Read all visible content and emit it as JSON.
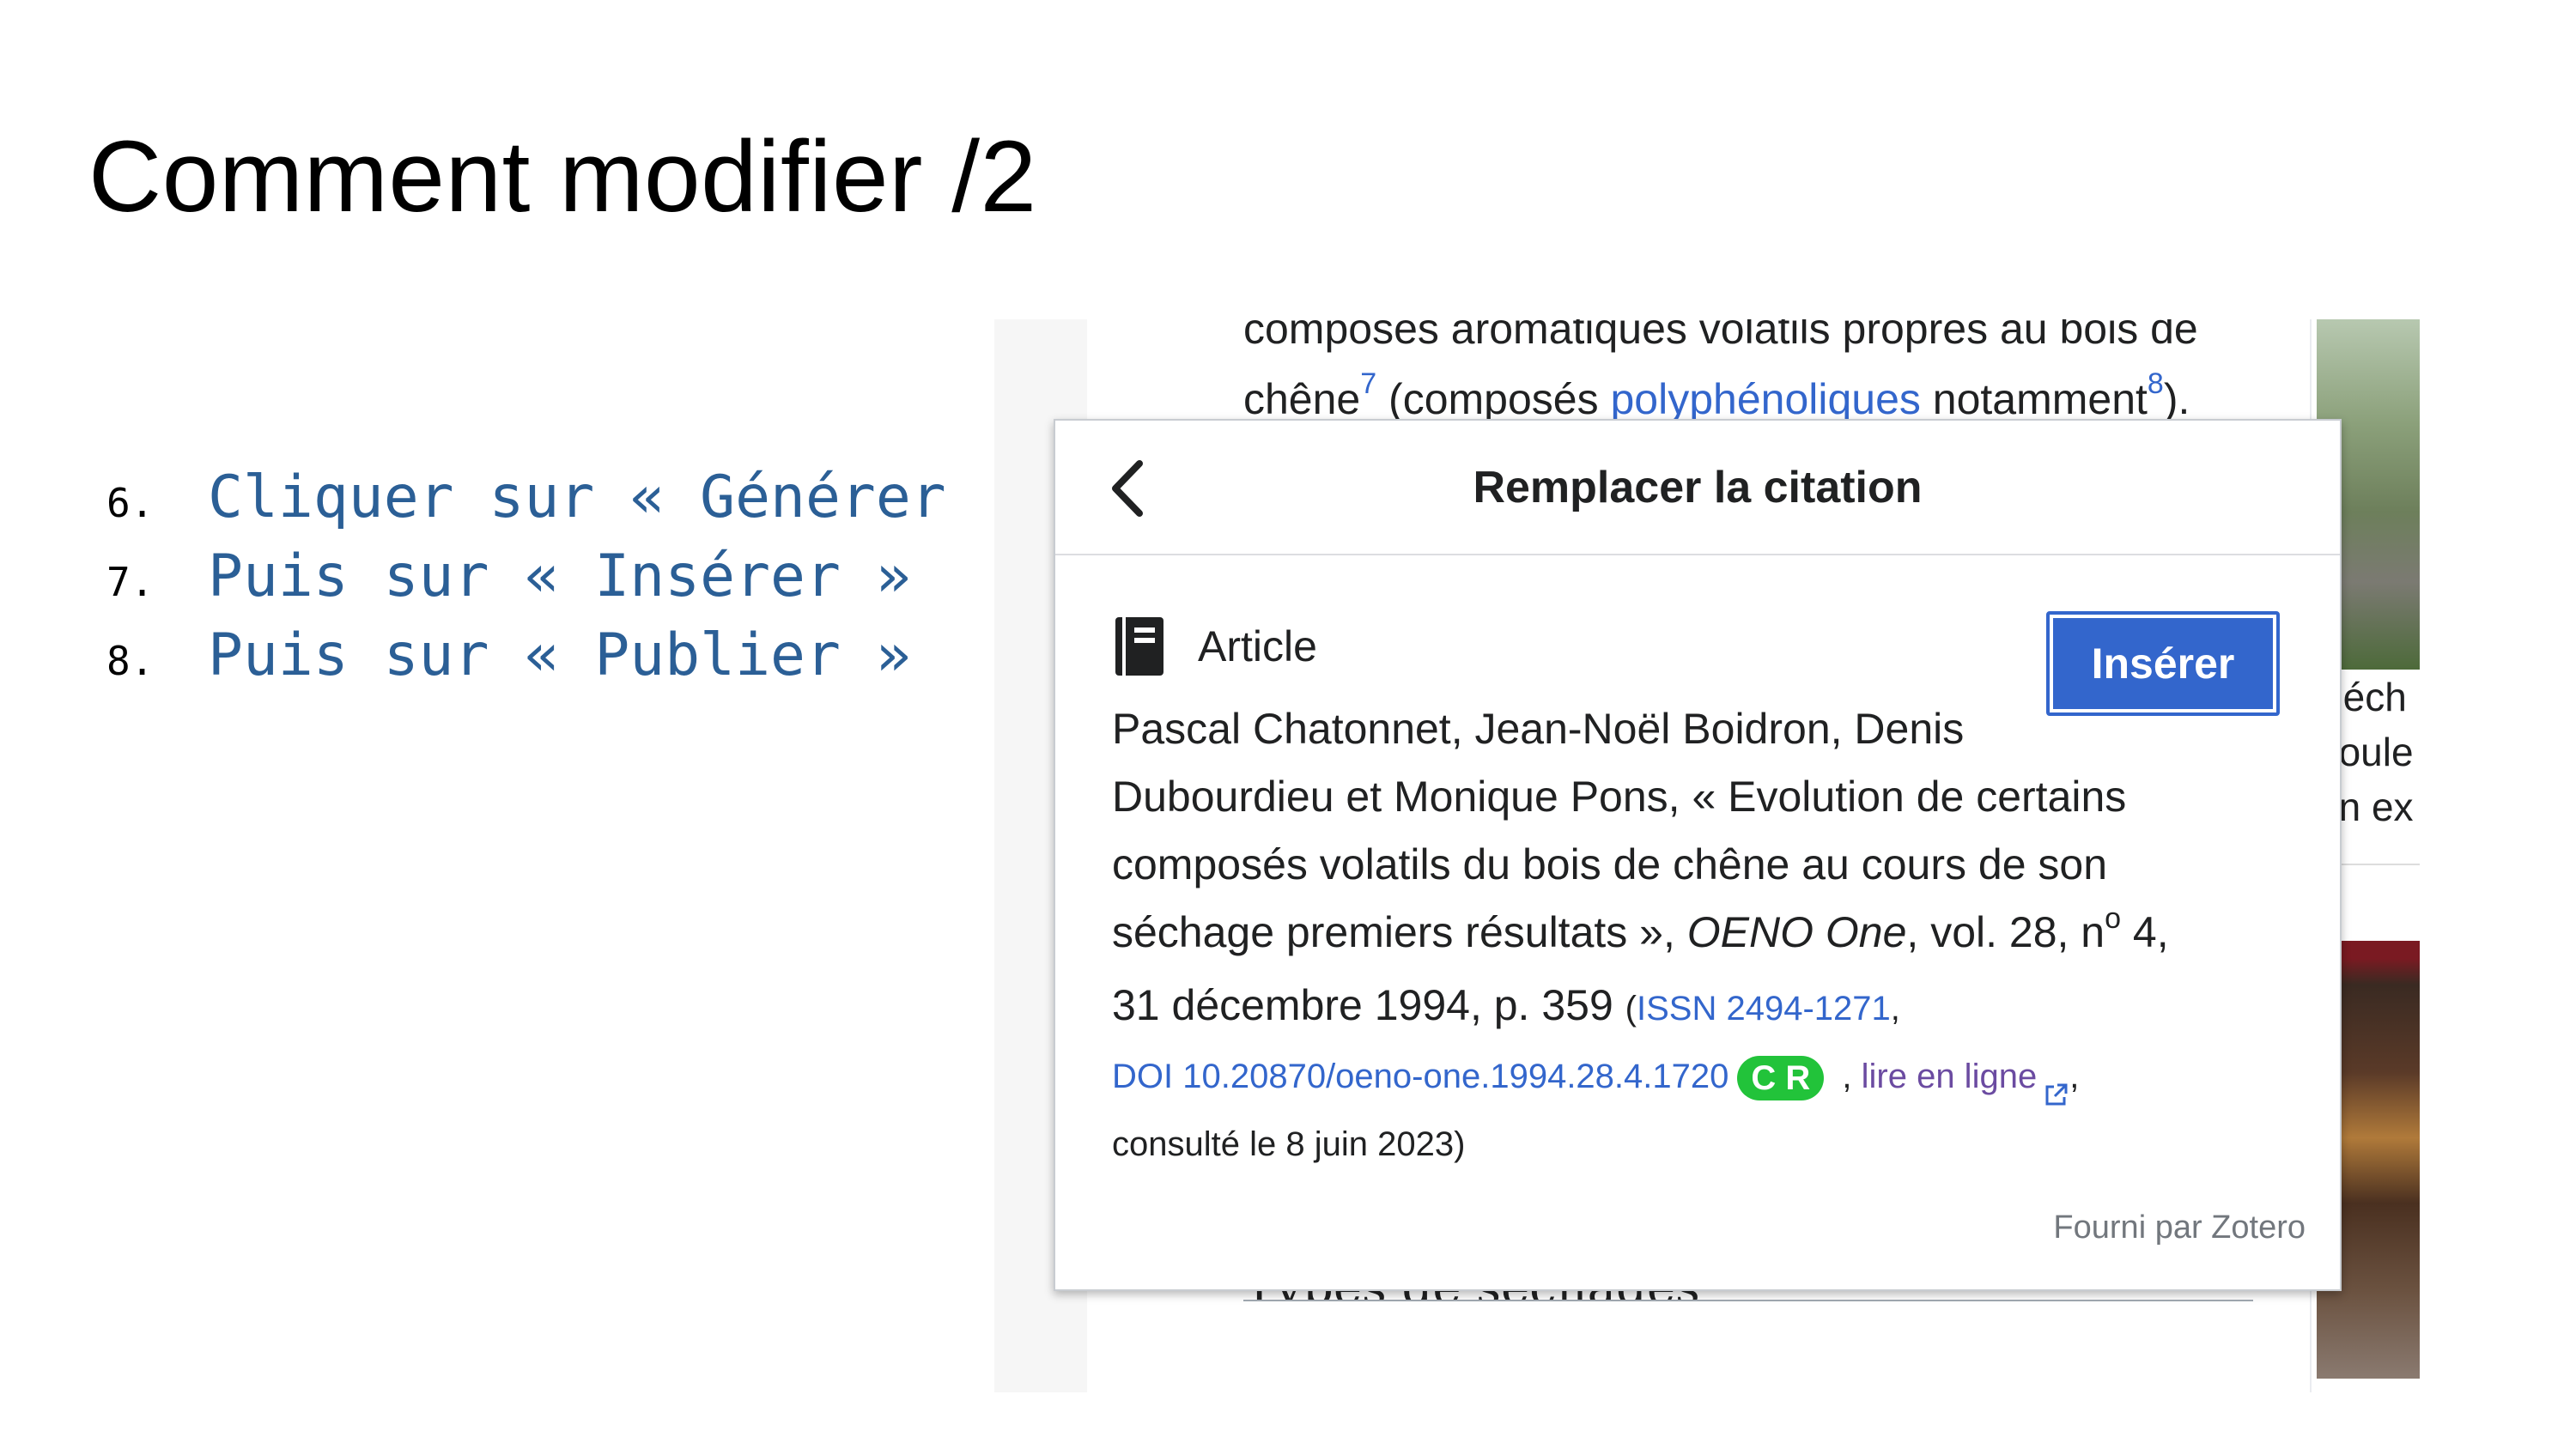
{
  "slide": {
    "title": "Comment modifier /2",
    "steps": [
      {
        "num": "6.",
        "text": "Cliquer sur « Générer"
      },
      {
        "num": "7.",
        "text": "Puis sur « Insérer »"
      },
      {
        "num": "8.",
        "text": "Puis sur « Publier »"
      }
    ]
  },
  "article": {
    "line1": "composés aromatiques volatils propres au bois de",
    "line2_a": "chêne",
    "ref7": "7",
    "line2_b": " (composés ",
    "link_poly": "polyphénoliques",
    "line2_c": " notamment",
    "ref8": "8",
    "line2_d": ").",
    "heading_partial": "Types de séchages",
    "side_caption": [
      "Séch",
      "boule",
      "en ex"
    ]
  },
  "dialog": {
    "title": "Remplacer la citation",
    "type_label": "Article",
    "insert_label": "Insérer",
    "citation": {
      "l1": "Pascal Chatonnet, Jean-Noël Boidron, Denis",
      "l2": "Dubourdieu et Monique Pons, « Evolution de certains",
      "l3": "composés volatils du bois de chêne au cours de son",
      "l4_a": "séchage premiers résultats », ",
      "l4_journal": "OENO One",
      "l4_b": ", vol. 28, n",
      "l4_sup": "o",
      "l4_c": " 4,",
      "l5_a": "31 décembre 1994, p. 359 ",
      "l5_paren_open": "(",
      "l5_issn": "ISSN 2494-1271",
      "l5_comma": ",",
      "l6_doi": "DOI 10.20870/oeno-one.1994.28.4.1720",
      "l6_badge": "C R",
      "l6_sep": " , ",
      "l6_online": "lire en ligne",
      "l6_end": ",",
      "l7": "consulté le 8 juin 2023)"
    },
    "provider": "Fourni par Zotero"
  },
  "icons": {
    "back": "chevron-left-icon",
    "type": "book-icon",
    "external": "external-link-icon"
  }
}
